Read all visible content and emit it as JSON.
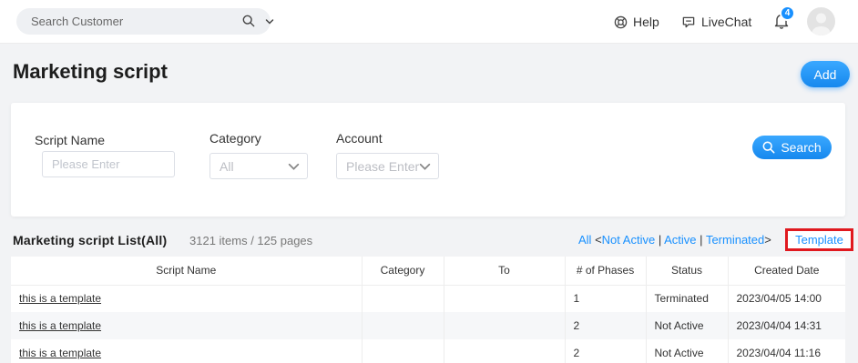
{
  "topbar": {
    "search_placeholder": "Search Customer",
    "help_label": "Help",
    "livechat_label": "LiveChat",
    "notification_count": "4"
  },
  "page": {
    "title": "Marketing script",
    "add_label": "Add"
  },
  "filters": {
    "script_name_label": "Script Name",
    "script_name_placeholder": "Please Enter",
    "category_label": "Category",
    "category_value": "All",
    "account_label": "Account",
    "account_placeholder": "Please Enter",
    "search_label": "Search"
  },
  "list": {
    "title": "Marketing script List(All)",
    "count": "3121 items / 125 pages",
    "status_filters": {
      "all": "All",
      "open": "<",
      "not_active": "Not Active",
      "sep": "|",
      "active": "Active",
      "terminated": "Terminated",
      "close": ">"
    },
    "template_label": "Template",
    "columns": [
      "Script Name",
      "Category",
      "To",
      "# of Phases",
      "Status",
      "Created Date"
    ],
    "rows": [
      {
        "name": "this is a template",
        "category": "",
        "to": "",
        "phases": "1",
        "status": "Terminated",
        "created": "2023/04/05 14:00"
      },
      {
        "name": "this is a template",
        "category": "",
        "to": "",
        "phases": "2",
        "status": "Not Active",
        "created": "2023/04/04 14:31"
      },
      {
        "name": "this is a template",
        "category": "",
        "to": "",
        "phases": "2",
        "status": "Not Active",
        "created": "2023/04/04 11:16"
      }
    ]
  },
  "colors": {
    "accent": "#1890ff",
    "highlight_border": "#e0191f"
  }
}
